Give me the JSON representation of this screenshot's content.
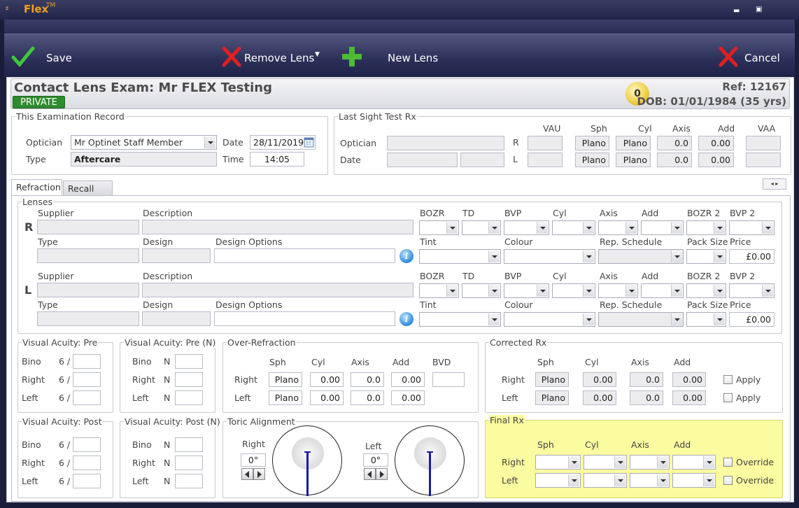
{
  "app": {
    "title": "Flex",
    "tm": "TM"
  },
  "toolbar": {
    "save": "Save",
    "remove_lens": "Remove Lens",
    "new_lens": "New Lens",
    "cancel": "Cancel"
  },
  "header": {
    "title": "Contact Lens Exam: Mr FLEX Testing",
    "badge": "PRIVATE",
    "count": "0",
    "ref": "Ref: 12167",
    "dob": "DOB: 01/01/1984 (35 yrs)"
  },
  "exam_record": {
    "legend": "This Examination Record",
    "optician_label": "Optician",
    "optician_value": "Mr Optinet Staff Member",
    "type_label": "Type",
    "type_value": "Aftercare",
    "date_label": "Date",
    "date_value": "28/11/2019",
    "time_label": "Time",
    "time_value": "14:05"
  },
  "last_sight": {
    "legend": "Last Sight Test Rx",
    "optician_label": "Optician",
    "date_label": "Date",
    "r": "R",
    "l": "L",
    "headers": {
      "vau": "VAU",
      "sph": "Sph",
      "cyl": "Cyl",
      "axis": "Axis",
      "add": "Add",
      "vaa": "VAA"
    },
    "right": {
      "sph": "Plano",
      "cyl": "Plano",
      "axis": "0.0",
      "add": "0.00"
    },
    "left": {
      "sph": "Plano",
      "cyl": "Plano",
      "axis": "0.0",
      "add": "0.00"
    }
  },
  "tabs": {
    "refraction": "Refraction",
    "recall": "Recall"
  },
  "lenses": {
    "legend": "Lenses",
    "r": "R",
    "l": "L",
    "supplier": "Supplier",
    "description": "Description",
    "type": "Type",
    "design": "Design",
    "design_options": "Design Options",
    "bozr": "BOZR",
    "td": "TD",
    "bvp": "BVP",
    "cyl": "Cyl",
    "axis": "Axis",
    "add": "Add",
    "bozr2": "BOZR 2",
    "bvp2": "BVP 2",
    "tint": "Tint",
    "colour": "Colour",
    "rep_schedule": "Rep. Schedule",
    "pack_size": "Pack Size",
    "price": "Price",
    "right_price": "£0.00",
    "left_price": "£0.00"
  },
  "va_pre": {
    "legend": "Visual Acuity: Pre",
    "bino": "Bino",
    "right": "Right",
    "left": "Left",
    "prefix": "6 /"
  },
  "va_pre_n": {
    "legend": "Visual Acuity: Pre (N)",
    "bino": "Bino",
    "right": "Right",
    "left": "Left",
    "prefix": "N"
  },
  "va_post": {
    "legend": "Visual Acuity: Post",
    "bino": "Bino",
    "right": "Right",
    "left": "Left",
    "prefix": "6 /"
  },
  "va_post_n": {
    "legend": "Visual Acuity: Post (N)",
    "bino": "Bino",
    "right": "Right",
    "left": "Left",
    "prefix": "N"
  },
  "over_refraction": {
    "legend": "Over-Refraction",
    "sph": "Sph",
    "cyl": "Cyl",
    "axis": "Axis",
    "add": "Add",
    "bvd": "BVD",
    "right": "Right",
    "left": "Left",
    "right_vals": {
      "sph": "Plano",
      "cyl": "0.00",
      "axis": "0.0",
      "add": "0.00"
    },
    "left_vals": {
      "sph": "Plano",
      "cyl": "0.00",
      "axis": "0.0",
      "add": "0.00"
    }
  },
  "corrected_rx": {
    "legend": "Corrected Rx",
    "sph": "Sph",
    "cyl": "Cyl",
    "axis": "Axis",
    "add": "Add",
    "right": "Right",
    "left": "Left",
    "apply": "Apply",
    "right_vals": {
      "sph": "Plano",
      "cyl": "0.00",
      "axis": "0.0",
      "add": "0.00"
    },
    "left_vals": {
      "sph": "Plano",
      "cyl": "0.00",
      "axis": "0.0",
      "add": "0.00"
    }
  },
  "toric": {
    "legend": "Toric Alignment",
    "right": "Right",
    "left": "Left",
    "right_value": "0°",
    "left_value": "0°"
  },
  "final_rx": {
    "legend": "Final Rx",
    "sph": "Sph",
    "cyl": "Cyl",
    "axis": "Axis",
    "add": "Add",
    "right": "Right",
    "left": "Left",
    "override": "Override"
  },
  "colors": {
    "accent_green": "#2e8b2e",
    "final_rx_bg": "#fbfba0",
    "title_orange": "#f0a020"
  }
}
